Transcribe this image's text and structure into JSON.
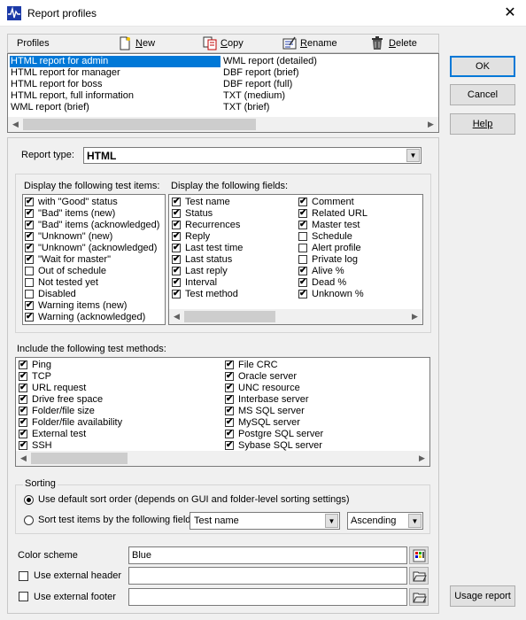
{
  "window": {
    "title": "Report profiles",
    "close_glyph": "✕"
  },
  "toolbar": {
    "profiles_label": "Profiles",
    "new_label": "New",
    "new_key": "N",
    "copy_label": "Copy",
    "copy_key": "C",
    "rename_label": "Rename",
    "rename_key": "R",
    "delete_label": "Delete",
    "delete_key": "D"
  },
  "profiles": {
    "col1": [
      "HTML report for admin",
      "HTML report for manager",
      "HTML report for boss",
      "HTML report, full information",
      "WML report (brief)"
    ],
    "col2": [
      "WML report (detailed)",
      "DBF report (brief)",
      "DBF report (full)",
      "TXT (medium)",
      "TXT (brief)"
    ],
    "selected": "HTML report for admin"
  },
  "buttons": {
    "ok": "OK",
    "cancel": "Cancel",
    "help": "Help",
    "usage_report": "Usage report"
  },
  "report_type": {
    "label": "Report type:",
    "value": "HTML"
  },
  "test_items": {
    "title": "Display the following test items:",
    "items": [
      {
        "label": "with \"Good\" status",
        "checked": true
      },
      {
        "label": "\"Bad\" items (new)",
        "checked": true
      },
      {
        "label": "\"Bad\" items (acknowledged)",
        "checked": true
      },
      {
        "label": "\"Unknown\" (new)",
        "checked": true
      },
      {
        "label": "\"Unknown\" (acknowledged)",
        "checked": true
      },
      {
        "label": "\"Wait for master\"",
        "checked": true
      },
      {
        "label": "Out of schedule",
        "checked": false
      },
      {
        "label": "Not tested yet",
        "checked": false
      },
      {
        "label": "Disabled",
        "checked": false
      },
      {
        "label": "Warning items (new)",
        "checked": true
      },
      {
        "label": "Warning (acknowledged)",
        "checked": true
      }
    ]
  },
  "fields": {
    "title": "Display the following fields:",
    "col1": [
      {
        "label": "Test name",
        "checked": true
      },
      {
        "label": "Status",
        "checked": true
      },
      {
        "label": "Recurrences",
        "checked": true
      },
      {
        "label": "Reply",
        "checked": true
      },
      {
        "label": "Last test time",
        "checked": true
      },
      {
        "label": "Last status",
        "checked": true
      },
      {
        "label": "Last reply",
        "checked": true
      },
      {
        "label": "Interval",
        "checked": true
      },
      {
        "label": "Test method",
        "checked": true
      }
    ],
    "col2": [
      {
        "label": "Comment",
        "checked": true
      },
      {
        "label": "Related URL",
        "checked": true
      },
      {
        "label": "Master test",
        "checked": true
      },
      {
        "label": "Schedule",
        "checked": false
      },
      {
        "label": "Alert profile",
        "checked": false
      },
      {
        "label": "Private log",
        "checked": false
      },
      {
        "label": "Alive %",
        "checked": true
      },
      {
        "label": "Dead %",
        "checked": true
      },
      {
        "label": "Unknown %",
        "checked": true
      }
    ]
  },
  "methods": {
    "title": "Include the following test methods:",
    "col1": [
      {
        "label": "Ping",
        "checked": true
      },
      {
        "label": "TCP",
        "checked": true
      },
      {
        "label": "URL request",
        "checked": true
      },
      {
        "label": "Drive free space",
        "checked": true
      },
      {
        "label": "Folder/file size",
        "checked": true
      },
      {
        "label": "Folder/file availability",
        "checked": true
      },
      {
        "label": "External test",
        "checked": true
      },
      {
        "label": "SSH",
        "checked": true
      }
    ],
    "col2": [
      {
        "label": "File CRC",
        "checked": true
      },
      {
        "label": "Oracle server",
        "checked": true
      },
      {
        "label": "UNC resource",
        "checked": true
      },
      {
        "label": "Interbase server",
        "checked": true
      },
      {
        "label": "MS SQL server",
        "checked": true
      },
      {
        "label": "MySQL server",
        "checked": true
      },
      {
        "label": "Postgre SQL server",
        "checked": true
      },
      {
        "label": "Sybase SQL server",
        "checked": true
      }
    ]
  },
  "sorting": {
    "title": "Sorting",
    "default_option": "Use default sort order (depends on GUI and folder-level sorting settings)",
    "field_option": "Sort test items by the following field",
    "selected": "default",
    "field_value": "Test name",
    "order_value": "Ascending"
  },
  "color_scheme": {
    "label": "Color scheme",
    "value": "Blue"
  },
  "external_header": {
    "label": "Use external header",
    "checked": false,
    "value": ""
  },
  "external_footer": {
    "label": "Use external footer",
    "checked": false,
    "value": ""
  },
  "icons": {
    "app": "app-pulse-icon",
    "new": "new-document-icon",
    "copy": "copy-icon",
    "rename": "rename-icon",
    "delete": "trash-icon",
    "folder": "folder-open-icon",
    "palette": "palette-icon",
    "check": "✔",
    "dropdown": "▼",
    "left": "◀",
    "right": "▶"
  }
}
